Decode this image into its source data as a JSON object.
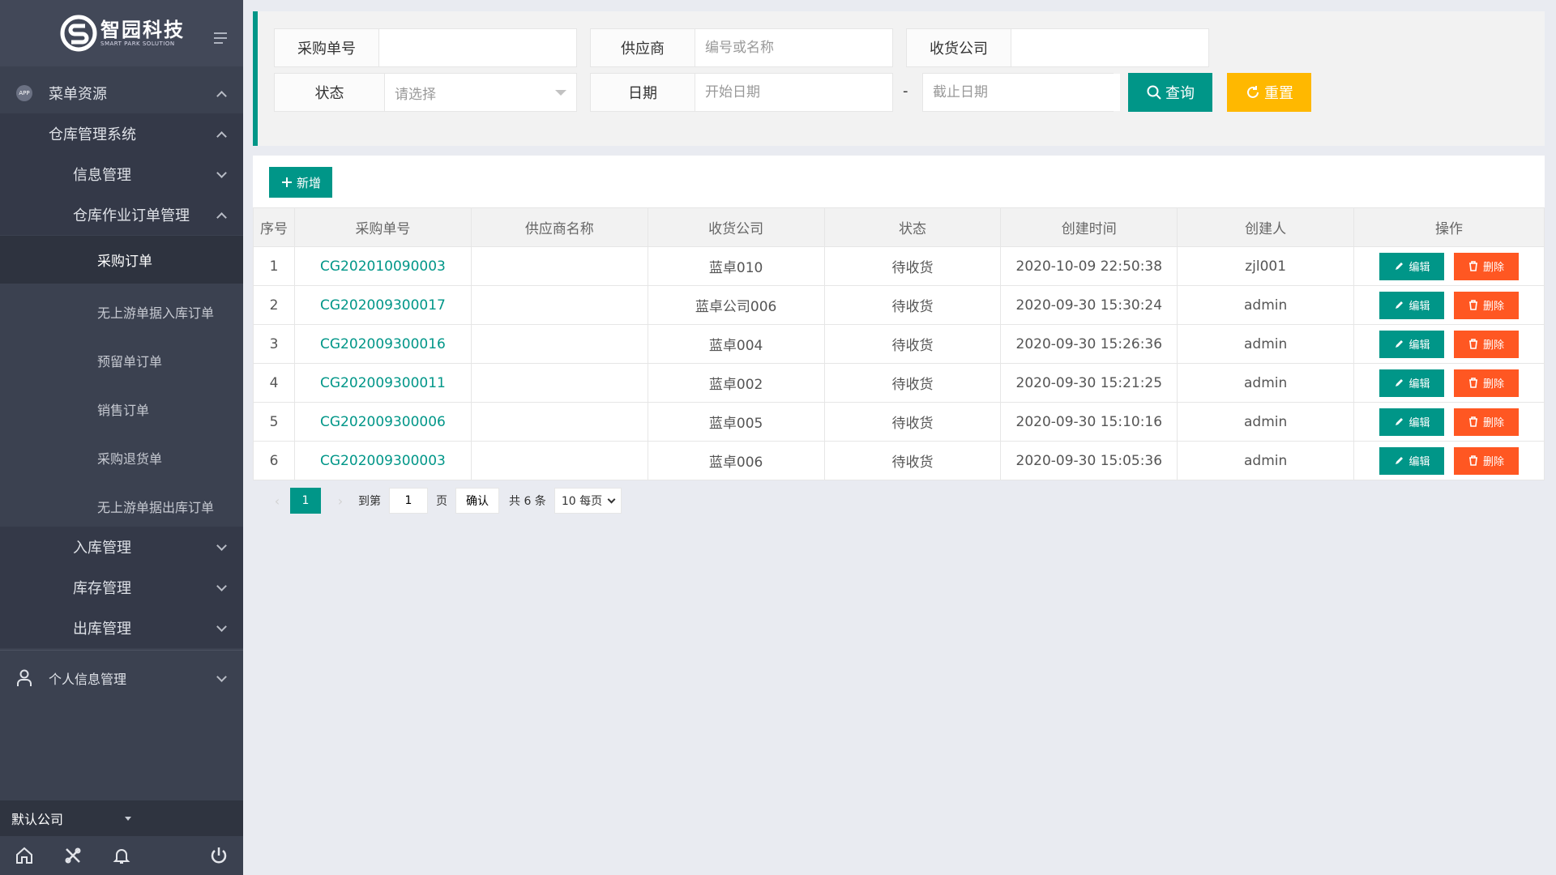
{
  "brand": {
    "name_cn": "智园科技",
    "name_en": "SMART PARK SOLUTION"
  },
  "sidebar": {
    "app_badge": "APP",
    "items": [
      {
        "label": "菜单资源",
        "state": "expanded"
      },
      {
        "label": "仓库管理系统",
        "state": "expanded"
      },
      {
        "label": "信息管理",
        "state": "collapsed"
      },
      {
        "label": "仓库作业订单管理",
        "state": "expanded"
      },
      {
        "label": "采购订单",
        "state": "active"
      },
      {
        "label": "无上游单据入库订单"
      },
      {
        "label": "预留单订单"
      },
      {
        "label": "销售订单"
      },
      {
        "label": "采购退货单"
      },
      {
        "label": "无上游单据出库订单"
      },
      {
        "label": "入库管理",
        "state": "collapsed"
      },
      {
        "label": "库存管理",
        "state": "collapsed"
      },
      {
        "label": "出库管理",
        "state": "collapsed"
      },
      {
        "label": "个人信息管理",
        "state": "collapsed"
      }
    ],
    "company": "默认公司",
    "bottom_icons": [
      "home-icon",
      "tools-icon",
      "bell-icon",
      "power-icon"
    ]
  },
  "search": {
    "order_no_label": "采购单号",
    "order_no_value": "",
    "supplier_label": "供应商",
    "supplier_placeholder": "编号或名称",
    "receiver_label": "收货公司",
    "receiver_value": "",
    "status_label": "状态",
    "status_placeholder": "请选择",
    "date_label": "日期",
    "start_placeholder": "开始日期",
    "date_separator": "-",
    "end_placeholder": "截止日期",
    "query_label": "查询",
    "reset_label": "重置"
  },
  "table": {
    "add_label": "新增",
    "headers": [
      "序号",
      "采购单号",
      "供应商名称",
      "收货公司",
      "状态",
      "创建时间",
      "创建人",
      "操作"
    ],
    "rows": [
      {
        "seq": "1",
        "order_no": "CG202010090003",
        "supplier": "",
        "receiver": "蓝卓010",
        "status": "待收货",
        "created": "2020-10-09 22:50:38",
        "creator": "zjl001"
      },
      {
        "seq": "2",
        "order_no": "CG202009300017",
        "supplier": "",
        "receiver": "蓝卓公司006",
        "status": "待收货",
        "created": "2020-09-30 15:30:24",
        "creator": "admin"
      },
      {
        "seq": "3",
        "order_no": "CG202009300016",
        "supplier": "",
        "receiver": "蓝卓004",
        "status": "待收货",
        "created": "2020-09-30 15:26:36",
        "creator": "admin"
      },
      {
        "seq": "4",
        "order_no": "CG202009300011",
        "supplier": "",
        "receiver": "蓝卓002",
        "status": "待收货",
        "created": "2020-09-30 15:21:25",
        "creator": "admin"
      },
      {
        "seq": "5",
        "order_no": "CG202009300006",
        "supplier": "",
        "receiver": "蓝卓005",
        "status": "待收货",
        "created": "2020-09-30 15:10:16",
        "creator": "admin"
      },
      {
        "seq": "6",
        "order_no": "CG202009300003",
        "supplier": "",
        "receiver": "蓝卓006",
        "status": "待收货",
        "created": "2020-09-30 15:05:36",
        "creator": "admin"
      }
    ],
    "edit_label": "编辑",
    "delete_label": "删除"
  },
  "pager": {
    "prev": "‹",
    "current": "1",
    "next": "›",
    "goto_label": "到第",
    "goto_value": "1",
    "page_unit": "页",
    "confirm_label": "确认",
    "total_text": "共 6 条",
    "page_size": "10 每页"
  },
  "colors": {
    "accent": "#009688",
    "warning": "#ffb800",
    "danger": "#ff5722",
    "sidebar": "#3b4150"
  }
}
